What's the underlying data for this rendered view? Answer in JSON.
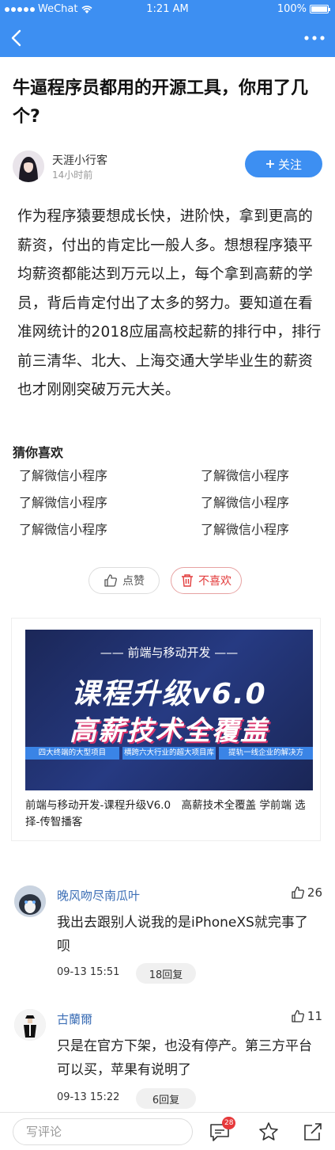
{
  "status_bar": {
    "carrier": "WeChat",
    "time": "1:21 AM",
    "battery": "100%",
    "battery_level": 1.0
  },
  "article": {
    "title": "牛逼程序员都用的开源工具，你用了几个?",
    "author": {
      "name": "天涯小行客",
      "time": "14小时前"
    },
    "follow_label": "关注",
    "body": "作为程序猿要想成长快，进阶快，拿到更高的薪资，付出的肯定比一般人多。想想程序猿平均薪资都能达到万元以上，每个拿到高薪的学员，背后肯定付出了太多的努力。要知道在看准网统计的2018应届高校起薪的排行中，排行前三清华、北大、上海交通大学毕业生的薪资也才刚刚突破万元大关。"
  },
  "guess": {
    "title": "猜你喜欢",
    "items": [
      "了解微信小程序",
      "了解微信小程序",
      "了解微信小程序",
      "了解微信小程序",
      "了解微信小程序",
      "了解微信小程序"
    ]
  },
  "reactions": {
    "like_label": "点赞",
    "dislike_label": "不喜欢"
  },
  "ad": {
    "banner_sub": "—— 前端与移动开发 ——",
    "banner_line1": "课程升级v6.0",
    "banner_line2": "高薪技术全覆盖",
    "banner_features": [
      "四大终端的大型项目",
      "横跨六大行业的超大项目库",
      "提轨一线企业的解决方"
    ],
    "caption": "前端与移动开发-课程升级V6.0　高薪技术全覆盖 学前端 选择-传智播客"
  },
  "comments": [
    {
      "name": "晚风吻尽南瓜叶",
      "likes": "26",
      "text": "我出去跟别人说我的是iPhoneXS就完事了呗",
      "time": "09-13 15:51",
      "reply": "18回复"
    },
    {
      "name": "古蘭爾",
      "likes": "11",
      "text": "只是在官方下架，也没有停产。第三方平台可以买，苹果有说明了",
      "time": "09-13 15:22",
      "reply": "6回复"
    }
  ],
  "bottom_bar": {
    "placeholder": "写评论",
    "comment_count": "28"
  },
  "colors": {
    "brand": "#3d8ff2",
    "dislike": "#e23b3b",
    "badge": "#e6393b",
    "link_name": "#3d6fb6"
  }
}
